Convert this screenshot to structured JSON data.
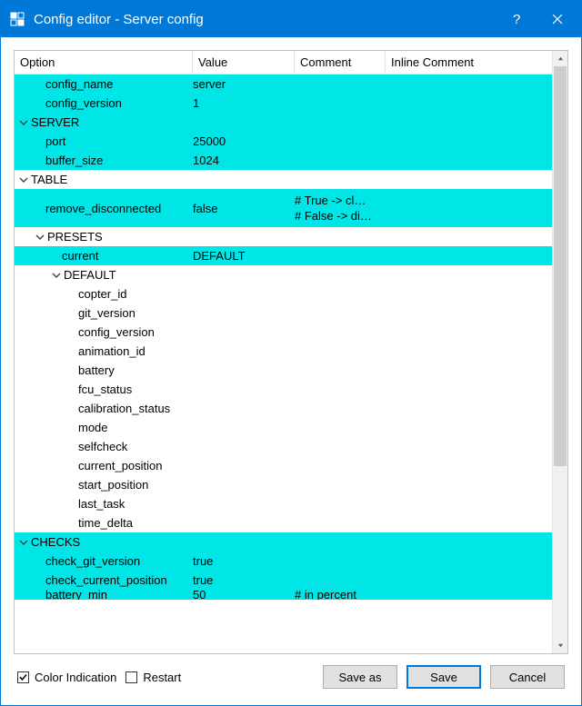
{
  "window": {
    "title": "Config editor - Server config"
  },
  "columns": {
    "option": "Option",
    "value": "Value",
    "comment": "Comment",
    "inline": "Inline Comment"
  },
  "rows": {
    "config_name": {
      "label": "config_name",
      "value": "server"
    },
    "config_version": {
      "label": "config_version",
      "value": "1"
    },
    "server": {
      "label": "SERVER"
    },
    "port": {
      "label": "port",
      "value": "25000"
    },
    "buffer_size": {
      "label": "buffer_size",
      "value": "1024"
    },
    "table": {
      "label": "TABLE"
    },
    "remove_disconnected": {
      "label": "remove_disconnected",
      "value": "false",
      "comment_line1": "# True  -> cl…",
      "comment_line2": "# False -> di…"
    },
    "presets": {
      "label": "PRESETS"
    },
    "current": {
      "label": "current",
      "value": "DEFAULT"
    },
    "default": {
      "label": "DEFAULT"
    },
    "copter_id": {
      "label": "copter_id"
    },
    "git_version": {
      "label": "git_version"
    },
    "config_version2": {
      "label": "config_version"
    },
    "animation_id": {
      "label": "animation_id"
    },
    "battery": {
      "label": "battery"
    },
    "fcu_status": {
      "label": "fcu_status"
    },
    "calibration_status": {
      "label": "calibration_status"
    },
    "mode": {
      "label": "mode"
    },
    "selfcheck": {
      "label": "selfcheck"
    },
    "current_position": {
      "label": "current_position"
    },
    "start_position": {
      "label": "start_position"
    },
    "last_task": {
      "label": "last_task"
    },
    "time_delta": {
      "label": "time_delta"
    },
    "checks": {
      "label": "CHECKS"
    },
    "check_git_version": {
      "label": "check_git_version",
      "value": "true"
    },
    "check_current_position": {
      "label": "check_current_position",
      "value": "true"
    },
    "battery_min": {
      "label": "battery_min",
      "value": "50",
      "comment": "# in percent"
    }
  },
  "footer": {
    "color_indication": "Color Indication",
    "restart": "Restart",
    "save_as": "Save as",
    "save": "Save",
    "cancel": "Cancel"
  }
}
